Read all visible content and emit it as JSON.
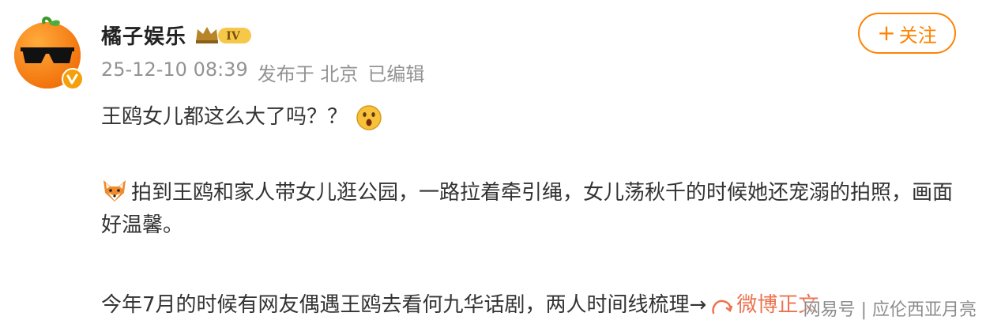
{
  "author": {
    "name": "橘子娱乐",
    "level_badge": "IV",
    "avatar_icon": "orange-sunglasses-avatar",
    "verified_icon": "verified-v-icon",
    "verified_color": "#f5a00a"
  },
  "meta": {
    "timestamp": "25-12-10 08:39",
    "published_from": "发布于 北京",
    "edited": "已编辑"
  },
  "follow_button": {
    "plus": "+",
    "label": "关注",
    "color": "#ff8200"
  },
  "post": {
    "line1": "王鸥女儿都这么大了吗？？",
    "line1_emoji": "surprised-face-emoji",
    "para2_icon": "fox-emoji",
    "para2": "拍到王鸥和家人带女儿逛公园，一路拉着牵引绳，女儿荡秋千的时候她还宠溺的拍照，画面好温馨。",
    "para3": "今年7月的时候有网友偶遇王鸥去看何九华话剧，两人时间线梳理→",
    "para3_link_icon": "link-icon",
    "para3_link_text": "微博正文",
    "link_color": "#eb7350"
  },
  "watermark": "网易号 | 应伦西亚月亮"
}
